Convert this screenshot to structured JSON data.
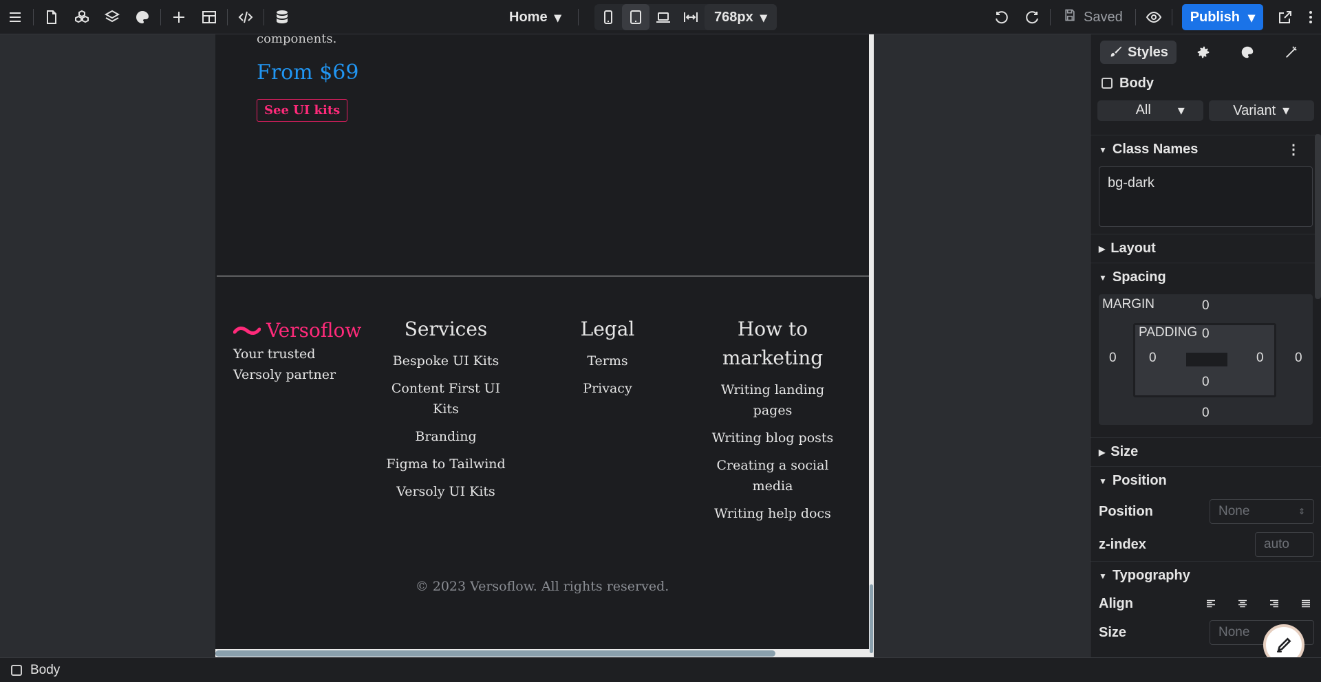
{
  "toolbar": {
    "page_name": "Home",
    "breakpoint": "768px",
    "saved_label": "Saved",
    "publish_label": "Publish"
  },
  "canvas": {
    "components_text": "components.",
    "price": "From $69",
    "kits_button": "See UI kits",
    "logo_text": "Versoflow",
    "tagline": "Your trusted Versoly partner",
    "services": {
      "heading": "Services",
      "links": [
        "Bespoke UI Kits",
        "Content First UI Kits",
        "Branding",
        "Figma to Tailwind",
        "Versoly UI Kits"
      ]
    },
    "legal": {
      "heading": "Legal",
      "links": [
        "Terms",
        "Privacy"
      ]
    },
    "marketing": {
      "heading": "How to marketing",
      "links": [
        "Writing landing pages",
        "Writing blog posts",
        "Creating a social media",
        "Writing help docs"
      ]
    },
    "copyright": "© 2023 Versoflow. All rights reserved."
  },
  "panel": {
    "tab_styles": "Styles",
    "selected_element": "Body",
    "screens_select": "All Screens",
    "variant_select": "Variant",
    "sections": {
      "class_names": "Class Names",
      "layout": "Layout",
      "spacing": "Spacing",
      "size": "Size",
      "position": "Position",
      "typography": "Typography"
    },
    "class_value": "bg-dark",
    "spacing": {
      "margin_label": "MARGIN",
      "padding_label": "PADDING",
      "margin_top": "0",
      "margin_right": "0",
      "margin_bottom": "0",
      "margin_left": "0",
      "padding_top": "0",
      "padding_right": "0",
      "padding_bottom": "0",
      "padding_left": "0"
    },
    "position_label": "Position",
    "position_value": "None",
    "zindex_label": "z-index",
    "zindex_placeholder": "auto",
    "align_label": "Align",
    "size_label": "Size",
    "size_value": "None"
  },
  "statusbar": {
    "element": "Body"
  },
  "colors": {
    "accent": "#1a73e8",
    "brand_pink": "#ff2a7a",
    "price_blue": "#2196f3",
    "canvas_bg": "#1c1d20"
  }
}
